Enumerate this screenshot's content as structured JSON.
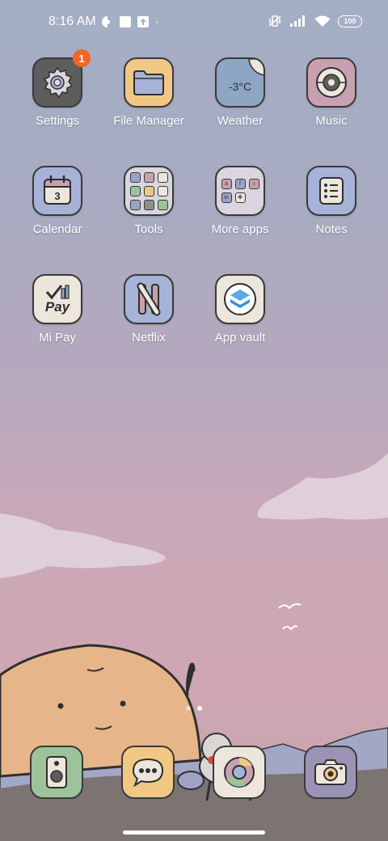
{
  "status_bar": {
    "time": "8:16 AM",
    "battery": "100",
    "icons": [
      "data-saver-icon",
      "square-notification-icon",
      "upload-icon",
      "dot-icon",
      "vibrate-mute-icon",
      "signal-icon",
      "wifi-icon",
      "battery-icon"
    ]
  },
  "apps": [
    {
      "label": "Settings",
      "badge": "1",
      "icon": "gear-icon",
      "color": "#5d5d5d"
    },
    {
      "label": "File Manager",
      "icon": "folder-icon",
      "color": "#f0c884"
    },
    {
      "label": "Weather",
      "temp": "-3°C",
      "icon": "weather-icon",
      "color": "#8da6c3"
    },
    {
      "label": "Music",
      "icon": "vinyl-icon",
      "color": "#c9a0b0"
    },
    {
      "label": "Calendar",
      "date": "3",
      "icon": "calendar-icon",
      "color": "#a7b3d6"
    },
    {
      "label": "Tools",
      "icon": "folder-tools-icon",
      "color": "#d9d6df"
    },
    {
      "label": "More apps",
      "icon": "folder-more-icon",
      "color": "#d9d6df",
      "mini": [
        "a",
        "f",
        "☺",
        "in",
        "✤"
      ]
    },
    {
      "label": "Notes",
      "icon": "checklist-icon",
      "color": "#a7b3d6"
    },
    {
      "label": "Mi Pay",
      "pay_text": "Pay",
      "icon": "mi-pay-icon",
      "color": "#ece6dc"
    },
    {
      "label": "Netflix",
      "icon": "netflix-icon",
      "color": "#a7b3d6"
    },
    {
      "label": "App vault",
      "icon": "app-vault-icon",
      "color": "#ece6dc"
    }
  ],
  "dock": [
    {
      "name": "phone",
      "icon": "phone-icon",
      "color": "#9cc39a"
    },
    {
      "name": "messages",
      "icon": "message-icon",
      "color": "#f0c884"
    },
    {
      "name": "browser",
      "icon": "browser-icon",
      "color": "#ece6dc"
    },
    {
      "name": "camera",
      "icon": "camera-icon",
      "color": "#9a93b5"
    }
  ],
  "page_indicator": {
    "pages": 2,
    "active": 2
  }
}
